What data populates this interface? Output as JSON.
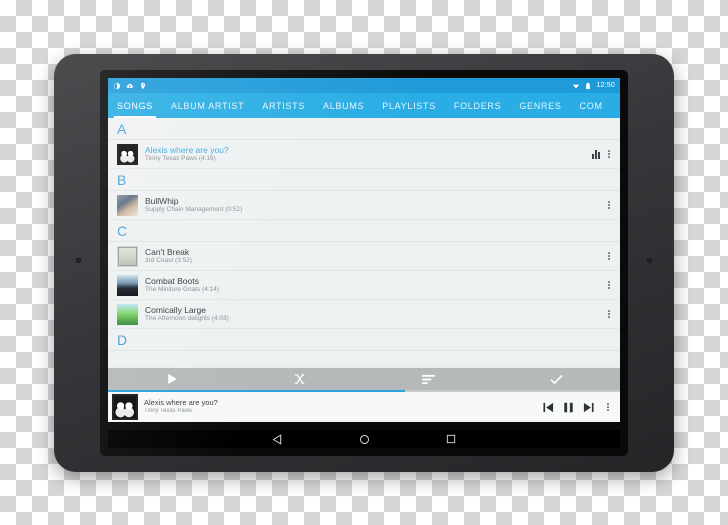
{
  "status_bar": {
    "icons": [
      "sync-icon",
      "cloud-icon",
      "location-icon"
    ],
    "wifi_icon": "wifi-icon",
    "battery_icon": "battery-icon",
    "clock": "12:50"
  },
  "tabs": [
    {
      "label": "SONGS",
      "active": true
    },
    {
      "label": "ALBUM ARTIST",
      "active": false
    },
    {
      "label": "ARTISTS",
      "active": false
    },
    {
      "label": "ALBUMS",
      "active": false
    },
    {
      "label": "PLAYLISTS",
      "active": false
    },
    {
      "label": "FOLDERS",
      "active": false
    },
    {
      "label": "GENRES",
      "active": false
    },
    {
      "label": "COM",
      "active": false
    }
  ],
  "list": [
    {
      "kind": "section",
      "label": "A"
    },
    {
      "kind": "song",
      "title": "Alexis where are you?",
      "subtitle": "Tinny Texas Paws (4:16)",
      "playing": true,
      "art": "aa-alexis",
      "equalizer_icon": "equalizer-icon",
      "overflow_icon": "overflow-menu-icon"
    },
    {
      "kind": "section",
      "label": "B"
    },
    {
      "kind": "song",
      "title": "BullWhip",
      "subtitle": "Supply Chain Management (0:52)",
      "playing": false,
      "art": "aa-bull",
      "overflow_icon": "overflow-menu-icon"
    },
    {
      "kind": "section",
      "label": "C"
    },
    {
      "kind": "song",
      "title": "Can't Break",
      "subtitle": "3rd Coast (3:52)",
      "playing": false,
      "art": "aa-cant",
      "overflow_icon": "overflow-menu-icon"
    },
    {
      "kind": "song",
      "title": "Combat Boots",
      "subtitle": "The Miniture Gnats (4:14)",
      "playing": false,
      "art": "aa-combat",
      "overflow_icon": "overflow-menu-icon"
    },
    {
      "kind": "song",
      "title": "Comically Large",
      "subtitle": "The Afternoon delights (4:03)",
      "playing": false,
      "art": "aa-comical",
      "overflow_icon": "overflow-menu-icon"
    },
    {
      "kind": "section",
      "label": "D"
    }
  ],
  "action_bar": {
    "buttons": [
      {
        "icon": "play-icon"
      },
      {
        "icon": "shuffle-icon"
      },
      {
        "icon": "sort-icon"
      },
      {
        "icon": "check-icon"
      }
    ]
  },
  "now_playing": {
    "title": "Alexis where are you?",
    "artist": "Tinny Texas Paws",
    "art": "aa-alexis",
    "progress_percent": 58,
    "controls": [
      {
        "icon": "previous-icon"
      },
      {
        "icon": "pause-icon"
      },
      {
        "icon": "next-icon"
      },
      {
        "icon": "overflow-menu-icon"
      }
    ]
  },
  "nav_bar": {
    "back_icon": "back-triangle-icon",
    "home_icon": "home-circle-icon",
    "recents_icon": "recents-square-icon"
  },
  "colors": {
    "accent": "#29ade4",
    "status_bar": "#1f9bd9",
    "playing_text": "#3ba7e0",
    "section_letter": "#4a9fd4",
    "action_bar": "#b6b9ba"
  }
}
